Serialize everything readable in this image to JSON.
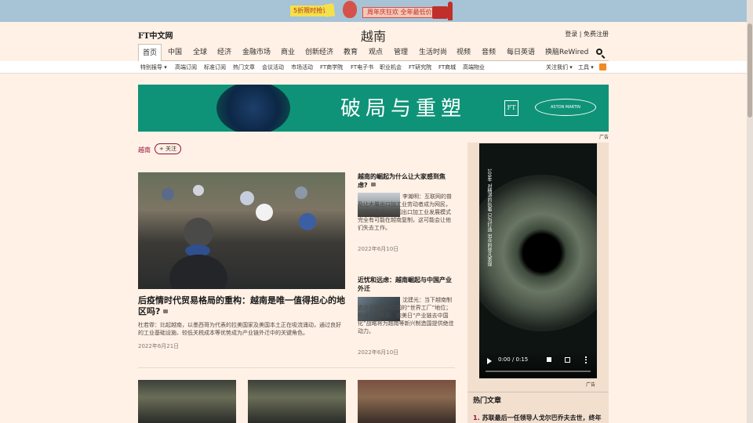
{
  "banner": {
    "tag": "5折限时抢订!",
    "promo": "周年庆狂欢 全年最低价!"
  },
  "header": {
    "logo": "FT中文网",
    "title": "越南",
    "login": "登录",
    "sep": " | ",
    "register": "免费注册"
  },
  "nav": {
    "items": [
      "首页",
      "中国",
      "全球",
      "经济",
      "金融市场",
      "商业",
      "创新经济",
      "教育",
      "观点",
      "管理",
      "生活时尚",
      "视频",
      "音频",
      "每日英语",
      "换脑ReWired"
    ],
    "active": "首页"
  },
  "subnav": {
    "items": [
      "特别报导 ▾",
      "高端订阅",
      "标准订阅",
      "热门文章",
      "会议活动",
      "市场活动",
      "FT商学院",
      "FT电子书",
      "职业机会",
      "FT研究院",
      "FT商城",
      "高端物业"
    ],
    "right": [
      "关注我们 ▾",
      "工具 ▾"
    ]
  },
  "ad": {
    "text": "破局与重塑",
    "ft_mark": "FT",
    "partner": "ASTON MARTIN",
    "label": "广告"
  },
  "topic": {
    "tag": "越南",
    "follow": "+ 关注"
  },
  "lead": {
    "title": "后疫情时代贸易格局的重构：越南是唯一值得担心的地区吗?",
    "summary": "杜若霏：比起越南，以墨西哥为代表的拉美国家及美国本土正在吸流涌动，通过良好的工业基础设施、较低关税成本等优势成为产业链外迁中的关键角色。",
    "date": "2022年6月21日"
  },
  "stories": [
    {
      "title": "越南的崛起为什么让大家感到焦虑?",
      "text": "李瀚明：互联网的普及让大量出口加工业劳动者成为网民，在他们看来，中国出口加工业发展模式完全有可能在越南复制，这可能会让他们失去工作。",
      "date": "2022年6月10日"
    },
    {
      "title": "近忧和远虑：越南崛起与中国产业外迁",
      "text": "沈建光：当下越南制造并不能撼动中国的“世界工厂”地位；但中长期来看，欧美日“产业链去中国化”战略将为越南等新兴制造国提供绝佳动力。",
      "date": "2022年6月10日"
    }
  ],
  "video": {
    "title": "109年 对精湛的执着 只为打造 出众的非凡表现",
    "time": "0:00 / 0:15",
    "progress": 0.0,
    "ad_label": "广告"
  },
  "rail": {
    "heading": "热门文章",
    "items": [
      {
        "num": "1.",
        "text": "苏联最后一任领导人戈尔巴乔夫去世，终年"
      }
    ]
  }
}
